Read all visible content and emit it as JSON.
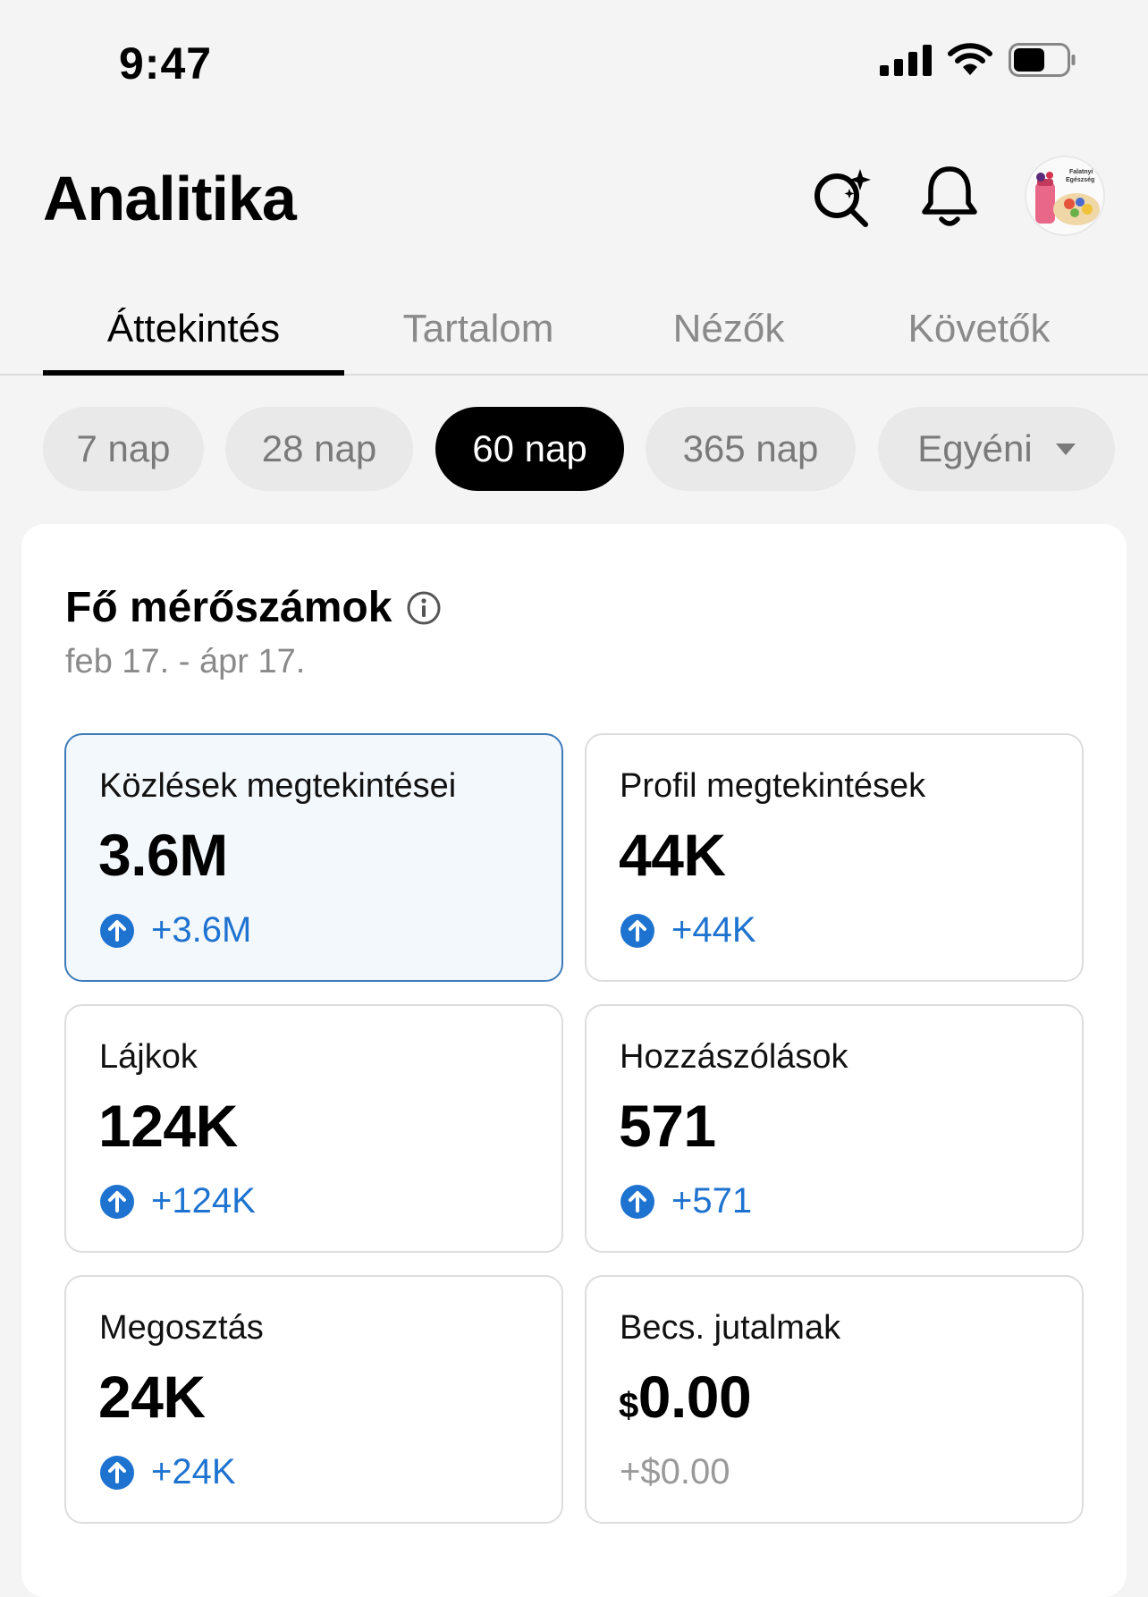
{
  "status_bar": {
    "time": "9:47"
  },
  "header": {
    "title": "Analitika",
    "avatar_logo_text": "Falatnyi Egészség"
  },
  "tabs": [
    {
      "label": "Áttekintés",
      "active": true
    },
    {
      "label": "Tartalom",
      "active": false
    },
    {
      "label": "Nézők",
      "active": false
    },
    {
      "label": "Követők",
      "active": false
    }
  ],
  "ranges": [
    {
      "label": "7 nap",
      "active": false
    },
    {
      "label": "28 nap",
      "active": false
    },
    {
      "label": "60 nap",
      "active": true
    },
    {
      "label": "365 nap",
      "active": false
    },
    {
      "label": "Egyéni",
      "active": false
    }
  ],
  "key_metrics": {
    "title": "Fő mérőszámok",
    "date_range": "feb 17. - ápr 17.",
    "cards": [
      {
        "label": "Közlések megtekintései",
        "value": "3.6M",
        "change": "+3.6M",
        "selected": true
      },
      {
        "label": "Profil megtekintések",
        "value": "44K",
        "change": "+44K"
      },
      {
        "label": "Lájkok",
        "value": "124K",
        "change": "+124K"
      },
      {
        "label": "Hozzászólások",
        "value": "571",
        "change": "+571"
      },
      {
        "label": "Megosztás",
        "value": "24K",
        "change": "+24K"
      },
      {
        "label": "Becs. jutalmak",
        "currency": "$",
        "value": "0.00",
        "change": "+$0.00"
      }
    ]
  },
  "colors": {
    "accent_blue": "#1f73d0",
    "selected_card_bg": "#f3f8fd",
    "selected_card_border": "#3d7ab8",
    "active_chip": "#000000"
  }
}
